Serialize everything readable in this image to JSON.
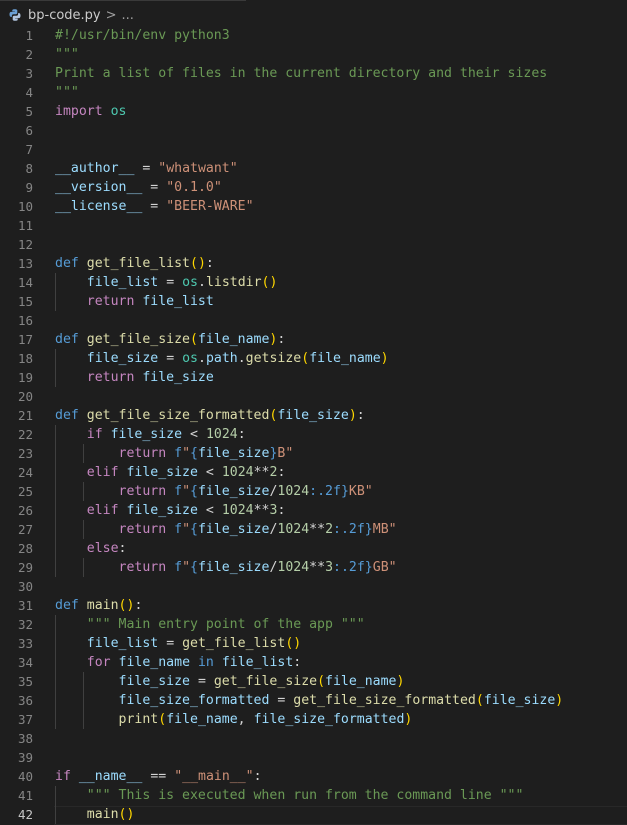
{
  "breadcrumb": {
    "file_name": "bp-code.py",
    "separator": ">",
    "more": "..."
  },
  "editor": {
    "language": "python",
    "current_line": 42,
    "lines": [
      "#!/usr/bin/env python3",
      "\"\"\"",
      "Print a list of files in the current directory and their sizes",
      "\"\"\"",
      "import os",
      "",
      "",
      "__author__ = \"whatwant\"",
      "__version__ = \"0.1.0\"",
      "__license__ = \"BEER-WARE\"",
      "",
      "",
      "def get_file_list():",
      "    file_list = os.listdir()",
      "    return file_list",
      "",
      "def get_file_size(file_name):",
      "    file_size = os.path.getsize(file_name)",
      "    return file_size",
      "",
      "def get_file_size_formatted(file_size):",
      "    if file_size < 1024:",
      "        return f\"{file_size}B\"",
      "    elif file_size < 1024**2:",
      "        return f\"{file_size/1024:.2f}KB\"",
      "    elif file_size < 1024**3:",
      "        return f\"{file_size/1024**2:.2f}MB\"",
      "    else:",
      "        return f\"{file_size/1024**3:.2f}GB\"",
      "",
      "def main():",
      "    \"\"\" Main entry point of the app \"\"\"",
      "    file_list = get_file_list()",
      "    for file_name in file_list:",
      "        file_size = get_file_size(file_name)",
      "        file_size_formatted = get_file_size_formatted(file_size)",
      "        print(file_name, file_size_formatted)",
      "",
      "",
      "if __name__ == \"__main__\":",
      "    \"\"\" This is executed when run from the command line \"\"\"",
      "    main()"
    ]
  },
  "colors": {
    "background": "#1e1e1e",
    "line_number": "#858585",
    "keyword": "#569cd6",
    "control": "#c586c0",
    "function": "#dcdcaa",
    "string": "#ce9178",
    "comment": "#6a9955",
    "variable": "#9cdcfe",
    "number": "#b5cea8",
    "module": "#4ec9b0"
  },
  "icons": {
    "file_type": "python-file-icon"
  }
}
